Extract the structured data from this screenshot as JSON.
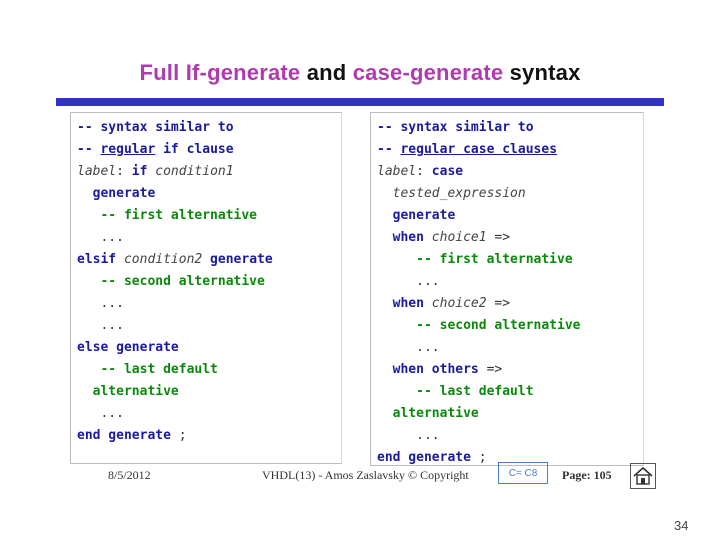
{
  "title": {
    "part1": "Full If-generate",
    "part2": "and",
    "part3": "case-generate",
    "part4": "syntax"
  },
  "left_panel": {
    "lines": [
      [
        {
          "t": "-- syntax similar to",
          "c": "kw"
        }
      ],
      [
        {
          "t": "-- ",
          "c": "kw"
        },
        {
          "t": "regular",
          "c": "kwu"
        },
        {
          "t": " if clause",
          "c": "kw"
        }
      ],
      [
        {
          "t": "label",
          "c": "it"
        },
        {
          "t": ": ",
          "c": "tx"
        },
        {
          "t": "if",
          "c": "kw"
        },
        {
          "t": " condition1",
          "c": "it"
        }
      ],
      [
        {
          "t": "  generate",
          "c": "kw"
        }
      ],
      [
        {
          "t": "   -- first alternative",
          "c": "cm"
        }
      ],
      [
        {
          "t": "   ...",
          "c": "tx"
        }
      ],
      [
        {
          "t": "elsif",
          "c": "kw"
        },
        {
          "t": " condition2",
          "c": "it"
        },
        {
          "t": " generate",
          "c": "kw"
        }
      ],
      [
        {
          "t": "   -- second alternative",
          "c": "cm"
        }
      ],
      [
        {
          "t": "   ...",
          "c": "tx"
        }
      ],
      [
        {
          "t": "   ...",
          "c": "tx"
        }
      ],
      [
        {
          "t": "else generate",
          "c": "kw"
        }
      ],
      [
        {
          "t": "   -- last default",
          "c": "cm"
        }
      ],
      [
        {
          "t": "  alternative",
          "c": "cm"
        }
      ],
      [
        {
          "t": "   ...",
          "c": "tx"
        }
      ],
      [
        {
          "t": "end generate",
          "c": "kw"
        },
        {
          "t": " ;",
          "c": "tx"
        }
      ]
    ]
  },
  "right_panel": {
    "lines": [
      [
        {
          "t": "-- syntax similar to",
          "c": "kw"
        }
      ],
      [
        {
          "t": "-- ",
          "c": "kw"
        },
        {
          "t": "regular case clauses",
          "c": "kwu"
        }
      ],
      [
        {
          "t": "label",
          "c": "it"
        },
        {
          "t": ": ",
          "c": "tx"
        },
        {
          "t": "case",
          "c": "kw"
        }
      ],
      [
        {
          "t": "  tested_expression",
          "c": "it"
        }
      ],
      [
        {
          "t": "  generate",
          "c": "kw"
        }
      ],
      [
        {
          "t": "  when",
          "c": "kw"
        },
        {
          "t": " choice1",
          "c": "it"
        },
        {
          "t": " =>",
          "c": "tx"
        }
      ],
      [
        {
          "t": "     -- first alternative",
          "c": "cm"
        }
      ],
      [
        {
          "t": "     ...",
          "c": "tx"
        }
      ],
      [
        {
          "t": "  when",
          "c": "kw"
        },
        {
          "t": " choice2",
          "c": "it"
        },
        {
          "t": " =>",
          "c": "tx"
        }
      ],
      [
        {
          "t": "     -- second alternative",
          "c": "cm"
        }
      ],
      [
        {
          "t": "     ...",
          "c": "tx"
        }
      ],
      [
        {
          "t": "  when others",
          "c": "kw"
        },
        {
          "t": " =>",
          "c": "tx"
        }
      ],
      [
        {
          "t": "     -- last default",
          "c": "cm"
        }
      ],
      [
        {
          "t": "  alternative",
          "c": "cm"
        }
      ],
      [
        {
          "t": "     ...",
          "c": "tx"
        }
      ],
      [
        {
          "t": "end generate",
          "c": "kw"
        },
        {
          "t": " ;",
          "c": "tx"
        }
      ]
    ]
  },
  "footer": {
    "date": "8/5/2012",
    "course": "VHDL(13) - Amos Zaslavsky © Copyright",
    "badge": "C= C8",
    "page": "Page: 105"
  },
  "slide_number": "34",
  "colors": {
    "title_magenta": "#b03ab0",
    "rule_blue": "#3333cc",
    "keyword_blue": "#1a1aa0",
    "comment_green": "#0a8a0a"
  }
}
